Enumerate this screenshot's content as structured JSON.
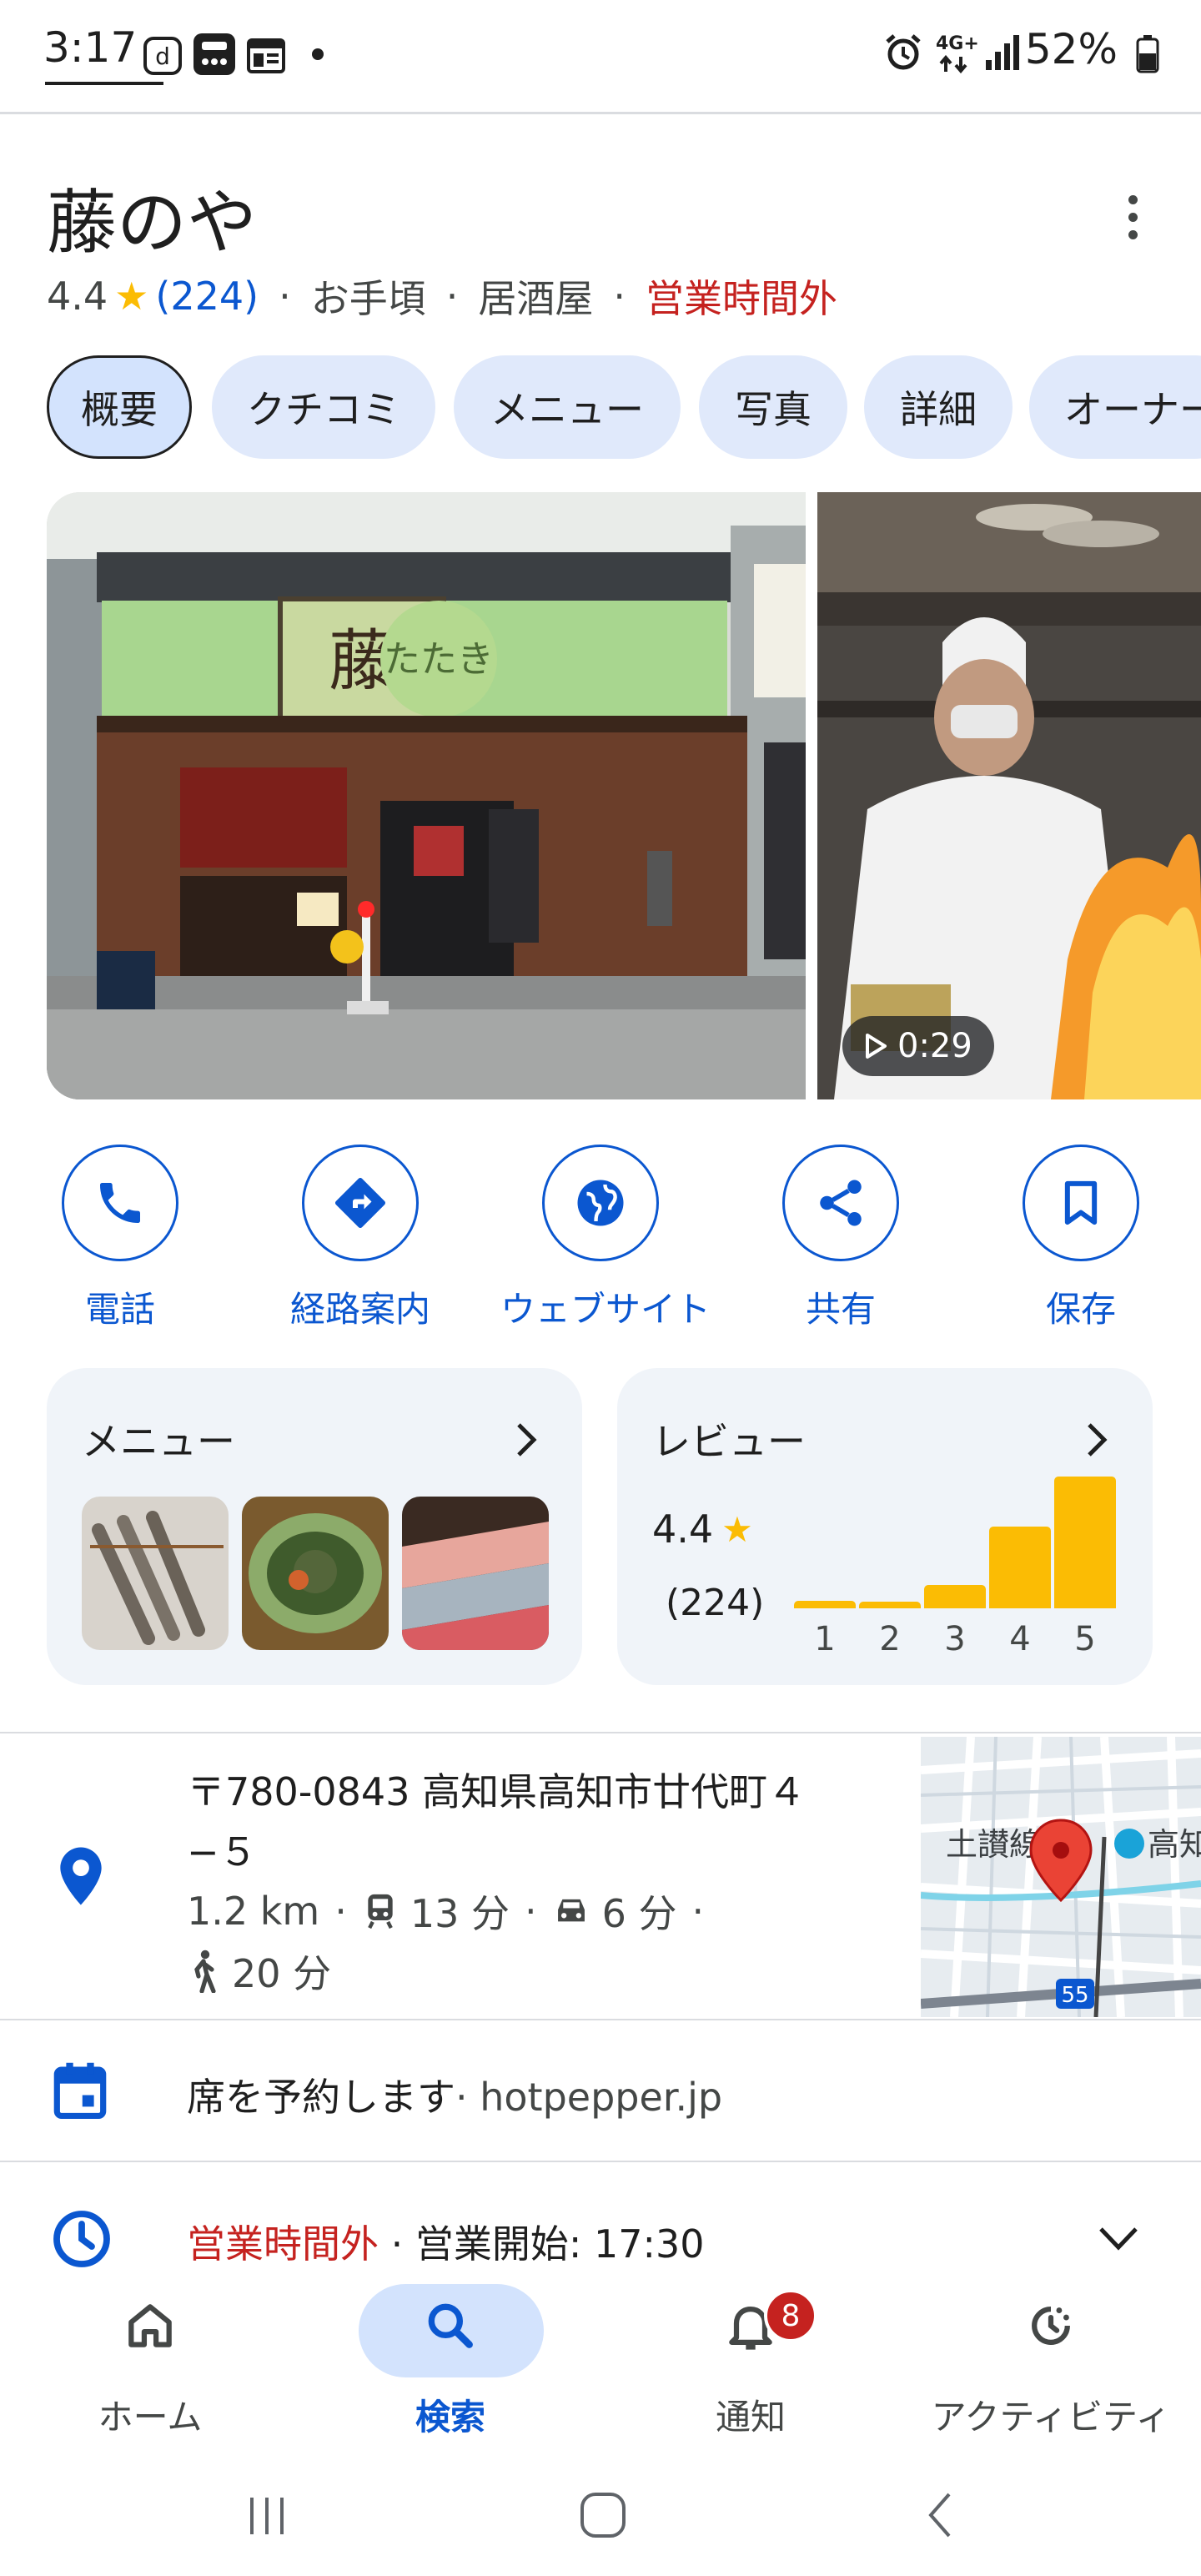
{
  "status_bar": {
    "time": "3:17",
    "network": "4G+",
    "battery": "52%"
  },
  "place": {
    "name": "藤のや",
    "rating": "4.4",
    "review_count": "(224)",
    "price": "お手頃",
    "category": "居酒屋",
    "open_status": "営業時間外"
  },
  "tabs": [
    "概要",
    "クチコミ",
    "メニュー",
    "写真",
    "詳細",
    "オーナー"
  ],
  "photos": {
    "video_duration": "0:29",
    "storefront_banner": "たたき"
  },
  "actions": [
    {
      "label": "電話",
      "icon": "phone-icon"
    },
    {
      "label": "経路案内",
      "icon": "directions-icon"
    },
    {
      "label": "ウェブサイト",
      "icon": "globe-icon"
    },
    {
      "label": "共有",
      "icon": "share-icon"
    },
    {
      "label": "保存",
      "icon": "bookmark-icon"
    }
  ],
  "menu_card": {
    "title": "メニュー"
  },
  "review_card": {
    "title": "レビュー",
    "score": "4.4",
    "count": "(224)",
    "distribution": [
      {
        "stars": "1",
        "share": 0.06
      },
      {
        "stars": "2",
        "share": 0.05
      },
      {
        "stars": "3",
        "share": 0.18
      },
      {
        "stars": "4",
        "share": 0.62
      },
      {
        "stars": "5",
        "share": 1.0
      }
    ]
  },
  "address": {
    "line1": "〒780-0843 高知県高知市廿代町４",
    "line2": "−５",
    "distance": "1.2 km",
    "transit_time": "13 分",
    "drive_time": "6 分",
    "walk_time": "20 分",
    "map_label_line": "土讃線",
    "map_label_city": "高知",
    "map_route": "55"
  },
  "reservation": {
    "text": "席を予約します",
    "source": "· hotpepper.jp"
  },
  "hours": {
    "status": "営業時間外",
    "detail": " · 営業開始: 17:30"
  },
  "bottom_nav": [
    {
      "label": "ホーム",
      "icon": "home-icon",
      "active": false
    },
    {
      "label": "検索",
      "icon": "search-icon",
      "active": true
    },
    {
      "label": "通知",
      "icon": "bell-icon",
      "active": false,
      "badge": "8"
    },
    {
      "label": "アクティビティ",
      "icon": "activity-icon",
      "active": false
    }
  ],
  "colors": {
    "accent": "#0b57d0",
    "closed": "#c5221f",
    "star": "#fbbc04",
    "chip": "#e0e9fb",
    "card": "#f0f4f9"
  }
}
